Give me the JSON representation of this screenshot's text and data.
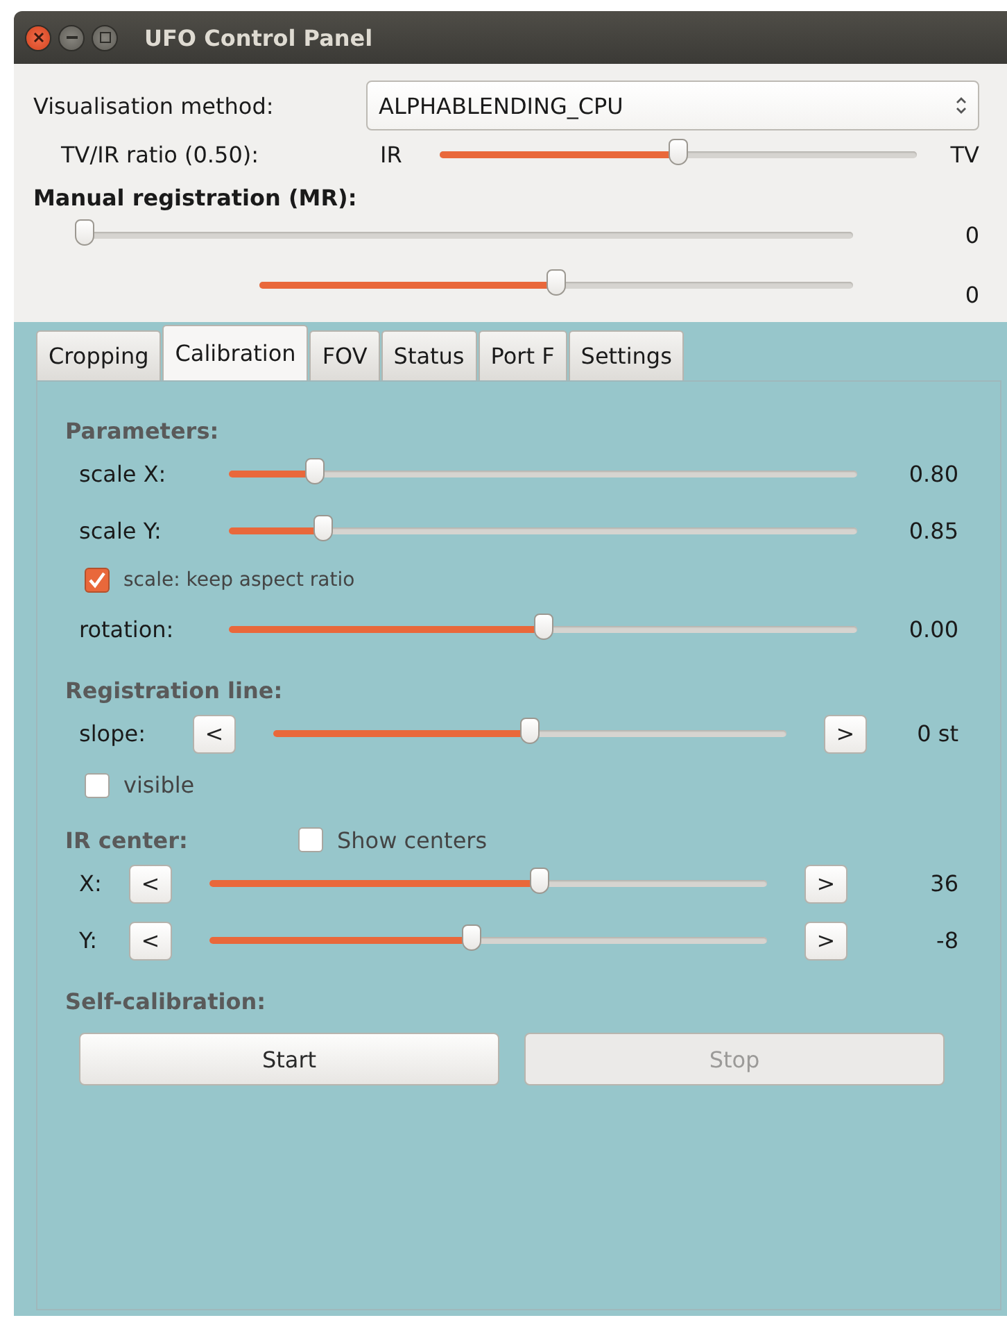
{
  "window": {
    "title": "UFO Control Panel"
  },
  "visualisation": {
    "label": "Visualisation method:",
    "value": "ALPHABLENDING_CPU"
  },
  "ratio": {
    "label": "TV/IR ratio (0.50):",
    "left": "IR",
    "right": "TV",
    "level": 0.5
  },
  "manual_registration": {
    "heading": "Manual registration (MR):",
    "sliders": [
      {
        "level": 0.0,
        "reading": "0"
      },
      {
        "level": 0.5,
        "reading": "0"
      }
    ]
  },
  "tabs": [
    {
      "label": "Cropping",
      "selected": false
    },
    {
      "label": "Calibration",
      "selected": true
    },
    {
      "label": "FOV",
      "selected": false
    },
    {
      "label": "Status",
      "selected": false
    },
    {
      "label": "Port F",
      "selected": false
    },
    {
      "label": "Settings",
      "selected": false
    }
  ],
  "sections": [
    {
      "heading": "Parameters:",
      "rows": [
        {
          "kind": "slider",
          "label": "scale X:",
          "level": 0.137,
          "reading": "0.80"
        },
        {
          "kind": "slider",
          "label": "scale Y:",
          "level": 0.15,
          "reading": "0.85"
        },
        {
          "kind": "checkbox",
          "label": "scale: keep aspect ratio",
          "checked": true
        },
        {
          "kind": "slider",
          "label": "rotation:",
          "level": 0.5,
          "reading": "0.00"
        }
      ]
    },
    {
      "heading": "Registration line:",
      "rows": [
        {
          "kind": "stepper",
          "label": "slope:",
          "decrement": "<",
          "increment": ">",
          "level": 0.5,
          "reading": "0 st"
        },
        {
          "kind": "checkbox",
          "label": "visible",
          "checked": false
        }
      ]
    },
    {
      "heading": "IR center:",
      "checkbox": {
        "label": "Show centers",
        "checked": false
      },
      "rows": [
        {
          "kind": "stepper",
          "label": "X:",
          "decrement": "<",
          "increment": ">",
          "level": 0.593,
          "reading": "36"
        },
        {
          "kind": "stepper",
          "label": "Y:",
          "decrement": "<",
          "increment": ">",
          "level": 0.47,
          "reading": "-8"
        }
      ]
    },
    {
      "heading": "Self-calibration:",
      "buttons": [
        {
          "label": "Start",
          "disabled": false
        },
        {
          "label": "Stop",
          "disabled": true
        }
      ]
    }
  ]
}
